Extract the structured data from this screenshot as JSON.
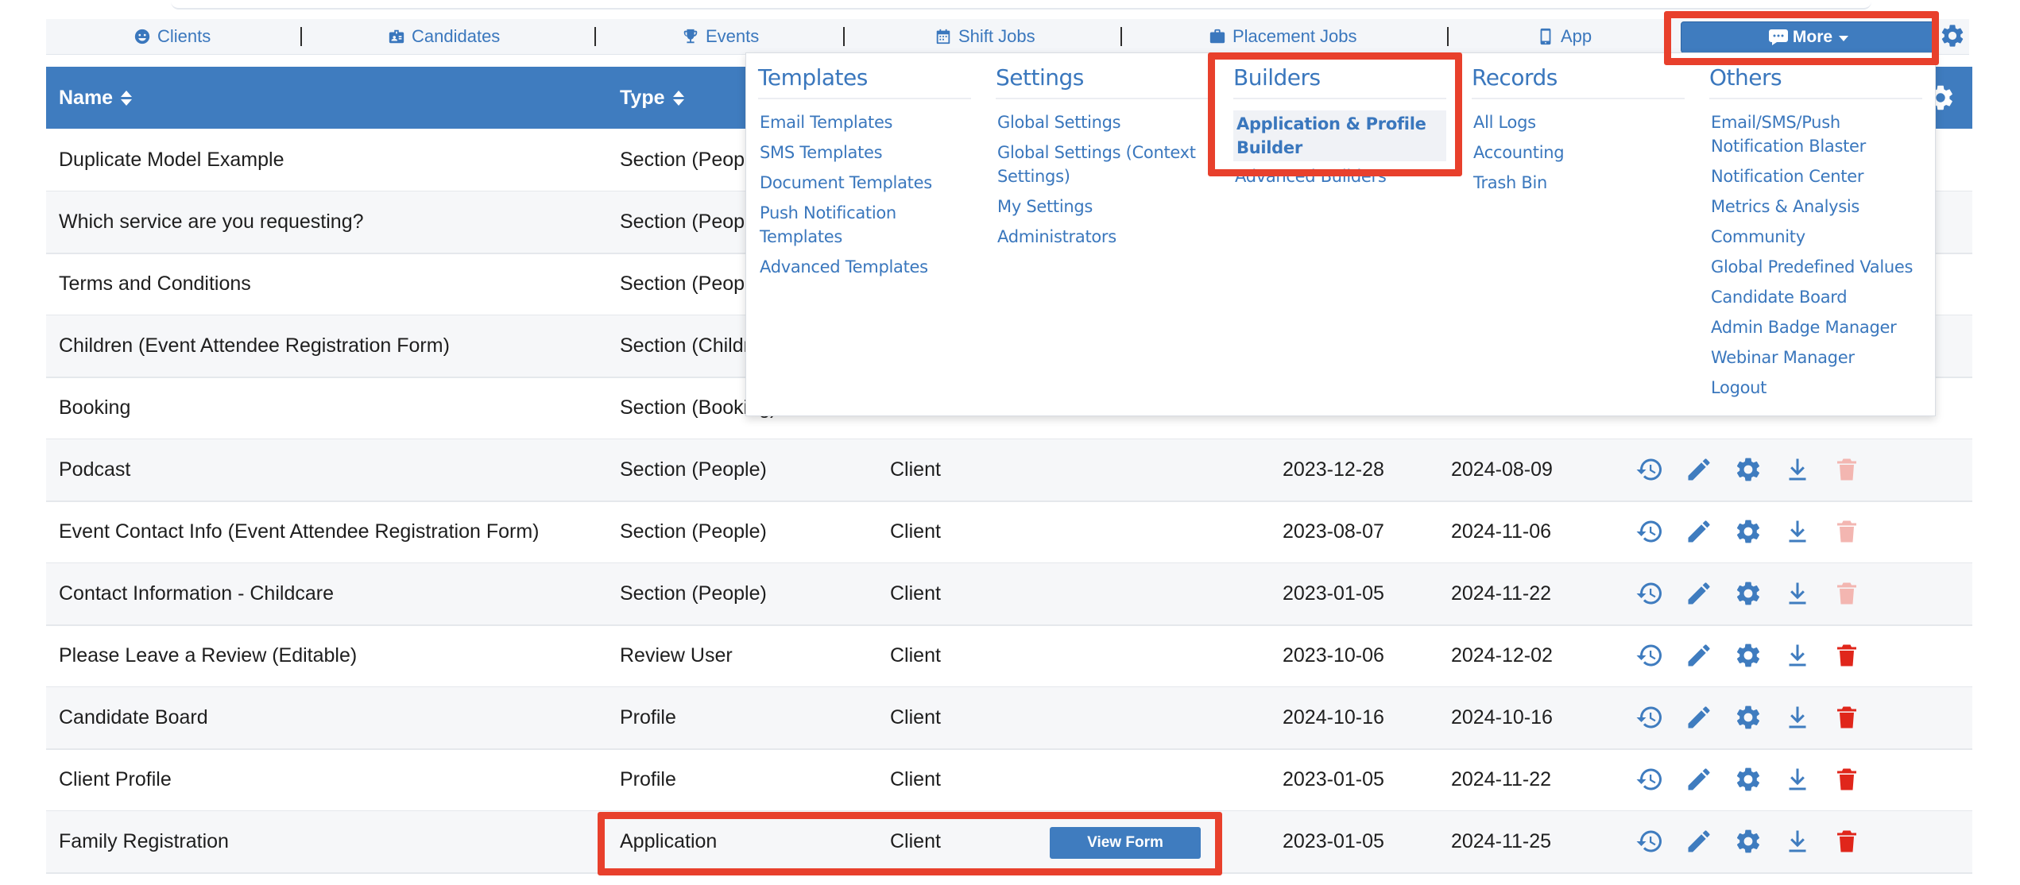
{
  "nav": {
    "items": [
      {
        "label": "Clients",
        "icon": "smile-icon"
      },
      {
        "label": "Candidates",
        "icon": "id-badge-icon"
      },
      {
        "label": "Events",
        "icon": "trophy-icon"
      },
      {
        "label": "Shift Jobs",
        "icon": "calendar-icon"
      },
      {
        "label": "Placement Jobs",
        "icon": "briefcase-icon"
      },
      {
        "label": "App",
        "icon": "mobile-icon"
      }
    ],
    "more_label": "More"
  },
  "table": {
    "headers": {
      "name": "Name",
      "type": "Type"
    },
    "rows": [
      {
        "name": "Duplicate Model Example",
        "type": "Section (People)",
        "owner": "",
        "created": "",
        "updated": ""
      },
      {
        "name": "Which service are you requesting?",
        "type": "Section (People)",
        "owner": "",
        "created": "",
        "updated": ""
      },
      {
        "name": "Terms and Conditions",
        "type": "Section (People)",
        "owner": "",
        "created": "",
        "updated": ""
      },
      {
        "name": "Children (Event Attendee Registration Form)",
        "type": "Section (Children)",
        "owner": "",
        "created": "",
        "updated": ""
      },
      {
        "name": "Booking",
        "type": "Section (Booking)",
        "owner": "",
        "created": "",
        "updated": ""
      },
      {
        "name": "Podcast",
        "type": "Section (People)",
        "owner": "Client",
        "created": "2023-12-28",
        "updated": "2024-08-09"
      },
      {
        "name": "Event Contact Info (Event Attendee Registration Form)",
        "type": "Section (People)",
        "owner": "Client",
        "created": "2023-08-07",
        "updated": "2024-11-06"
      },
      {
        "name": "Contact Information - Childcare",
        "type": "Section (People)",
        "owner": "Client",
        "created": "2023-01-05",
        "updated": "2024-11-22"
      },
      {
        "name": "Please Leave a Review (Editable)",
        "type": "Review User",
        "owner": "Client",
        "created": "2023-10-06",
        "updated": "2024-12-02"
      },
      {
        "name": "Candidate Board",
        "type": "Profile",
        "owner": "Client",
        "created": "2024-10-16",
        "updated": "2024-10-16"
      },
      {
        "name": "Client Profile",
        "type": "Profile",
        "owner": "Client",
        "created": "2023-01-05",
        "updated": "2024-11-22"
      },
      {
        "name": "Family Registration",
        "type": "Application",
        "owner": "Client",
        "created": "2023-01-05",
        "updated": "2024-11-25"
      }
    ],
    "view_form_label": "View Form"
  },
  "dropdown": {
    "templates": {
      "title": "Templates",
      "items": [
        "Email Templates",
        "SMS Templates",
        "Document Templates",
        "Push Notification Templates",
        "Advanced Templates"
      ]
    },
    "settings": {
      "title": "Settings",
      "items": [
        "Global Settings",
        "Global Settings (Context Settings)",
        "My Settings",
        "Administrators"
      ]
    },
    "builders": {
      "title": "Builders",
      "items": [
        "Application & Profile Builder",
        "Advanced Builders"
      ]
    },
    "records": {
      "title": "Records",
      "items": [
        "All Logs",
        "Accounting",
        "Trash Bin"
      ]
    },
    "others": {
      "title": "Others",
      "items": [
        "Email/SMS/Push Notification Blaster",
        "Notification Center",
        "Metrics & Analysis",
        "Community",
        "Global Predefined Values",
        "Candidate Board",
        "Admin Badge Manager",
        "Webinar Manager",
        "Logout"
      ]
    }
  },
  "colors": {
    "primary": "#3f7cbf",
    "link": "#3a77bd",
    "highlight": "#e8402c",
    "delete": "#e0261b",
    "delete_disabled": "#f3b6b1"
  }
}
